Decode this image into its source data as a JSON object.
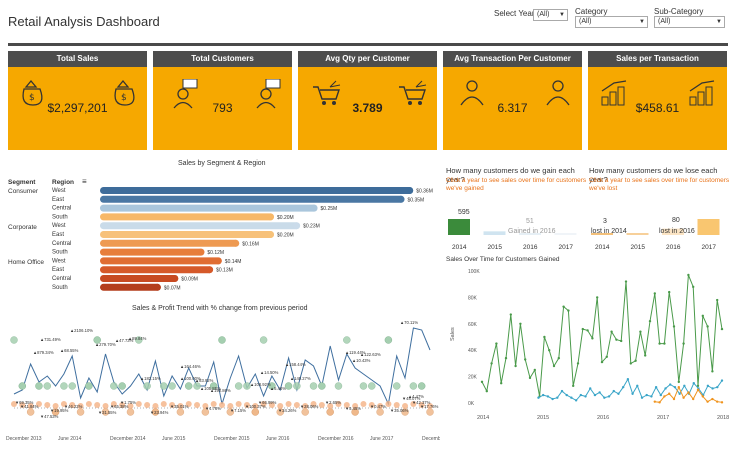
{
  "title": "Retail Analysis Dashboard",
  "filters": {
    "year_label": "Select Year",
    "year_value": "(All)",
    "category_label": "Category",
    "category_value": "(All)",
    "subcategory_label": "Sub-Category",
    "subcategory_value": "(All)"
  },
  "kpis": [
    {
      "label": "Total Sales",
      "value": "$2,297,201",
      "icon": "money-bag-icon"
    },
    {
      "label": "Total Customers",
      "value": "793",
      "icon": "customer-icon"
    },
    {
      "label": "Avg Qty per Customer",
      "value": "3.789",
      "icon": "shopping-cart-icon"
    },
    {
      "label": "Avg Transaction Per Customer",
      "value": "6.317",
      "icon": "person-icon"
    },
    {
      "label": "Sales per Transaction",
      "value": "$458.61",
      "icon": "coins-growth-icon"
    }
  ],
  "segment_chart": {
    "title": "Sales by Segment & Region",
    "col_segment": "Segment",
    "col_region": "Region",
    "segments": [
      "Consumer",
      "Corporate",
      "Home Office"
    ],
    "regions": [
      "West",
      "East",
      "Central",
      "South",
      "West",
      "East",
      "Central",
      "South",
      "West",
      "East",
      "Central",
      "South"
    ],
    "labels": [
      "$0.36M",
      "$0.35M",
      "$0.25M",
      "$0.20M",
      "$0.23M",
      "$0.20M",
      "$0.16M",
      "$0.12M",
      "$0.14M",
      "$0.13M",
      "$0.09M",
      "$0.07M"
    ],
    "colors": [
      "#3e6c9a",
      "#4a77a3",
      "#aac6dc",
      "#f7b868",
      "#c9dbe9",
      "#f7c17a",
      "#ee9a52",
      "#e77e3c",
      "#e06d33",
      "#d5592a",
      "#c74a22",
      "#b43d1c"
    ]
  },
  "chart_data": [
    {
      "type": "bar",
      "title": "Sales by Segment & Region",
      "categories": [
        "Consumer West",
        "Consumer East",
        "Consumer Central",
        "Consumer South",
        "Corporate West",
        "Corporate East",
        "Corporate Central",
        "Corporate South",
        "Home Office West",
        "Home Office East",
        "Home Office Central",
        "Home Office South"
      ],
      "values": [
        0.36,
        0.35,
        0.25,
        0.2,
        0.23,
        0.2,
        0.16,
        0.12,
        0.14,
        0.13,
        0.09,
        0.07
      ],
      "units": "$M"
    },
    {
      "type": "bar",
      "title": "How many customers do we gain each year?",
      "categories": [
        "2014",
        "2015",
        "2016",
        "2017"
      ],
      "values": [
        595,
        136,
        51,
        11
      ]
    },
    {
      "type": "bar",
      "title": "How many customers do we lose each year?",
      "categories": [
        "2014",
        "2015",
        "2016",
        "2017"
      ],
      "values": [
        3,
        20,
        80,
        200
      ]
    },
    {
      "type": "line",
      "title": "Sales Over Time for Customers Gained",
      "ylabel": "Sales",
      "x_ticks": [
        "2014",
        "2015",
        "2016",
        "2017",
        "2018"
      ],
      "y_ticks": [
        "0K",
        "20K",
        "40K",
        "60K",
        "80K",
        "100K"
      ],
      "series": [
        {
          "color": "#4a9a4a",
          "values": [
            16,
            9,
            30,
            45,
            15,
            34,
            67,
            28,
            60,
            33,
            19,
            25,
            5,
            50,
            40,
            28,
            34,
            73,
            70,
            13,
            30,
            56,
            55,
            49,
            80,
            31,
            35,
            54,
            48,
            47,
            92,
            30,
            32,
            54,
            36,
            62,
            83,
            45,
            45,
            84,
            58,
            16,
            45,
            97,
            88,
            13,
            66,
            58,
            24,
            78,
            56
          ]
        },
        {
          "color": "#3aa5c8",
          "values": [
            null,
            null,
            null,
            null,
            null,
            null,
            null,
            null,
            null,
            null,
            null,
            null,
            4,
            6,
            5,
            3,
            4,
            9,
            6,
            4,
            2,
            6,
            5,
            11,
            6,
            8,
            4,
            5,
            9,
            7,
            12,
            18,
            7,
            13,
            4,
            6,
            5,
            12,
            6,
            11,
            14,
            12,
            7,
            13,
            7,
            15,
            11,
            6,
            13,
            11,
            12,
            17
          ]
        },
        {
          "color": "#f0941e",
          "values": [
            null,
            null,
            null,
            null,
            null,
            null,
            null,
            null,
            null,
            null,
            null,
            null,
            null,
            null,
            null,
            null,
            null,
            null,
            null,
            null,
            null,
            null,
            null,
            null,
            null,
            null,
            null,
            null,
            null,
            null,
            null,
            null,
            null,
            null,
            null,
            null,
            1,
            0.5,
            5,
            7,
            3,
            12,
            4,
            8,
            3,
            10,
            5,
            1,
            3,
            1,
            0.5
          ]
        }
      ]
    }
  ],
  "gain": {
    "question": "How many customers do we gain each year?",
    "hint": "Click a year to see sales over time for customers we've gained",
    "label_2014": "595",
    "label_2016": "51",
    "caption": "Gained in 2016",
    "years": [
      "2014",
      "2015",
      "2016",
      "2017"
    ]
  },
  "lose": {
    "question": "How many customers do we lose each year?",
    "hint": "Click a year to see sales over time for customers we've lost",
    "label_2014": "3",
    "label_2016": "80",
    "caption_2014": "lost in 2014",
    "caption_2016": "lost in 2016",
    "years": [
      "2014",
      "2015",
      "2016",
      "2017"
    ]
  },
  "trend": {
    "title": "Sales & Profit Trend with % change from previous period",
    "x_ticks": [
      "December 2013",
      "June 2014",
      "December 2014",
      "June 2015",
      "December 2015",
      "June 2016",
      "December 2016",
      "June 2017",
      "December 2017"
    ],
    "annotations": [
      "▲731.49%",
      "▲2106.10%",
      "▲279.70%",
      "▲89.84%",
      "▲164.46%",
      "▲83.92%",
      "▲158.44%",
      "▲119.44%",
      "▲10.43%",
      "▲70.11%",
      "▲879.34%",
      "▲68.55%",
      "▲47.73%",
      "▲182.15%",
      "▲105.85%",
      "▲190.86%",
      "▲108.92%",
      "▲14.50%",
      "▲5.46%",
      "▲140.27%",
      "▲100.00%",
      "▲122.63%",
      "▲4.47%",
      "▼69.35%",
      "▼19.95%",
      "▼47.53%",
      "▼46.22%",
      "▼31.55%",
      "▼65.38%",
      "▼1.75%",
      "▼23.94%",
      "▼35.01%",
      "▼4.78%",
      "▼7.15%",
      "▼100.37%",
      "▼66.99%",
      "▼34.26%",
      "▼28.06%",
      "▼2.65%",
      "▼5.45%",
      "▼0.47%",
      "▼35.06%",
      "▼48.07%",
      "▼42.37%",
      "▼17.76%",
      "▼41.84%"
    ],
    "sales_line_color": "#3f6f9f"
  },
  "sales_time": {
    "title": "Sales Over Time for Customers Gained",
    "ylabel": "Sales",
    "x_ticks": [
      "2014",
      "2015",
      "2016",
      "2017",
      "2018"
    ],
    "y_ticks": [
      "0K",
      "20K",
      "40K",
      "60K",
      "80K",
      "100K"
    ]
  }
}
